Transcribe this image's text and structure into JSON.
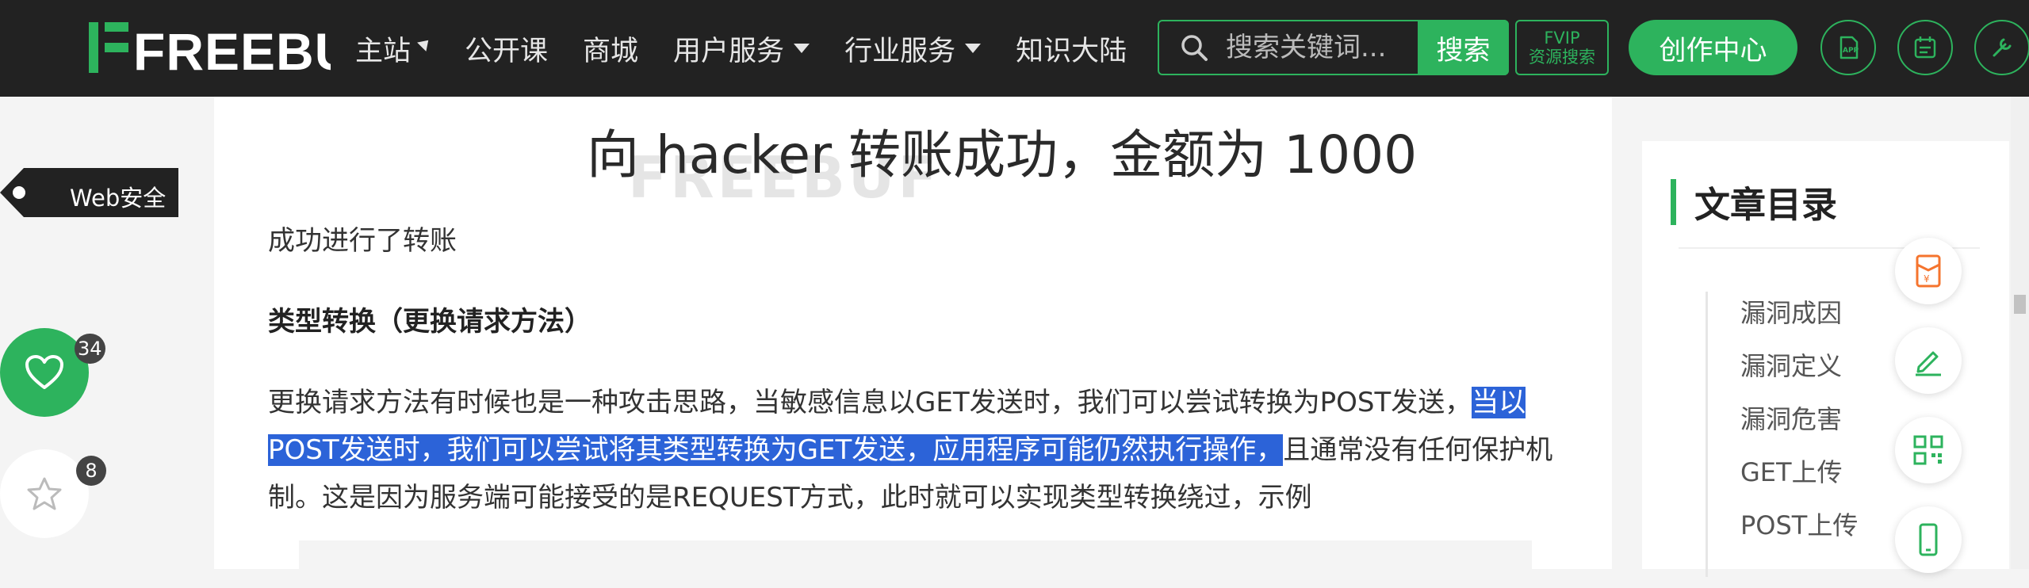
{
  "colors": {
    "brand_green": "#2db35d",
    "topbar_bg": "#222222",
    "selection_blue": "#2c63d8"
  },
  "header": {
    "logo_text": "FREEBUF",
    "nav": [
      {
        "label": "主站",
        "marker": "right-caret"
      },
      {
        "label": "公开课"
      },
      {
        "label": "商城"
      },
      {
        "label": "用户服务",
        "marker": "dropdown"
      },
      {
        "label": "行业服务",
        "marker": "dropdown"
      },
      {
        "label": "知识大陆"
      }
    ],
    "search": {
      "placeholder": "搜索关键词...",
      "button": "搜索"
    },
    "fvip": {
      "line1": "FVIP",
      "line2": "资源搜索"
    },
    "create_button": "创作中心",
    "icons": [
      "app-icon",
      "calendar-icon",
      "tools-icon"
    ]
  },
  "left_float": {
    "category_tag": "Web安全",
    "like_count": "34",
    "favorite_count": "8"
  },
  "article": {
    "image_caption": "向 hacker 转账成功，金额为 1000",
    "image_watermark": "FREEBUF",
    "p1": "成功进行了转账",
    "heading": "类型转换（更换请求方法）",
    "p2": {
      "line1_normal": "更换请求方法有时候也是一种攻击思路，当敏感信息以GET发送时，我们可以尝试转换为POST发送，",
      "line1_selected": "当以",
      "line2_selected": "POST发送时，我们可以尝试将其类型转换为GET发送，应用程序可能仍然执行操作，",
      "line2_normal": "且通常没有任何保护机",
      "line3": "制。这是因为服务端可能接受的是REQUEST方式，此时就可以实现类型转换绕过，示例"
    }
  },
  "toc": {
    "title": "文章目录",
    "items": [
      "漏洞成因",
      "漏洞定义",
      "漏洞危害",
      "GET上传",
      "POST上传"
    ]
  },
  "side_tools": [
    "red-envelope-icon",
    "edit-icon",
    "qrcode-icon",
    "mobile-icon"
  ]
}
